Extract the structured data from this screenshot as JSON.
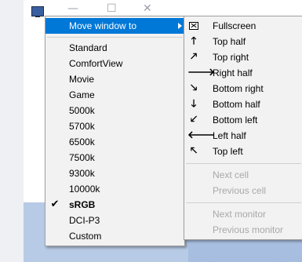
{
  "window": {
    "icon": "app-window-icon",
    "controls": {
      "minimize": "—",
      "maximize": "☐",
      "close": "✕"
    }
  },
  "main_menu": {
    "move_window_label": "Move window to",
    "items": [
      {
        "label": "Standard",
        "checked": false
      },
      {
        "label": "ComfortView",
        "checked": false
      },
      {
        "label": "Movie",
        "checked": false
      },
      {
        "label": "Game",
        "checked": false
      },
      {
        "label": "5000k",
        "checked": false
      },
      {
        "label": "5700k",
        "checked": false
      },
      {
        "label": "6500k",
        "checked": false
      },
      {
        "label": "7500k",
        "checked": false
      },
      {
        "label": "9300k",
        "checked": false
      },
      {
        "label": "10000k",
        "checked": false
      },
      {
        "label": "sRGB",
        "checked": true
      },
      {
        "label": "DCI-P3",
        "checked": false
      },
      {
        "label": "Custom",
        "checked": false
      }
    ],
    "check_glyph": "✔"
  },
  "sub_menu": {
    "items": [
      {
        "label": "Fullscreen",
        "icon": "fullscreen-icon",
        "glyph": ""
      },
      {
        "label": "Top half",
        "icon": "arrow-up-icon",
        "glyph": "🡑"
      },
      {
        "label": "Top right",
        "icon": "arrow-up-right-icon",
        "glyph": "🡕"
      },
      {
        "label": "Right half",
        "icon": "arrow-right-icon",
        "glyph": "🡒"
      },
      {
        "label": "Bottom right",
        "icon": "arrow-down-right-icon",
        "glyph": "🡖"
      },
      {
        "label": "Bottom half",
        "icon": "arrow-down-icon",
        "glyph": "🡓"
      },
      {
        "label": "Bottom left",
        "icon": "arrow-down-left-icon",
        "glyph": "🡗"
      },
      {
        "label": "Left half",
        "icon": "arrow-left-icon",
        "glyph": "🡐"
      },
      {
        "label": "Top left",
        "icon": "arrow-up-left-icon",
        "glyph": "🡔"
      }
    ],
    "cell_items": [
      {
        "label": "Next cell",
        "disabled": true
      },
      {
        "label": "Previous cell",
        "disabled": true
      }
    ],
    "monitor_items": [
      {
        "label": "Next monitor",
        "disabled": true
      },
      {
        "label": "Previous monitor",
        "disabled": true
      }
    ]
  },
  "colors": {
    "highlight": "#0078d7",
    "menu_bg": "#f2f2f2",
    "disabled_text": "#a8a8a8"
  }
}
